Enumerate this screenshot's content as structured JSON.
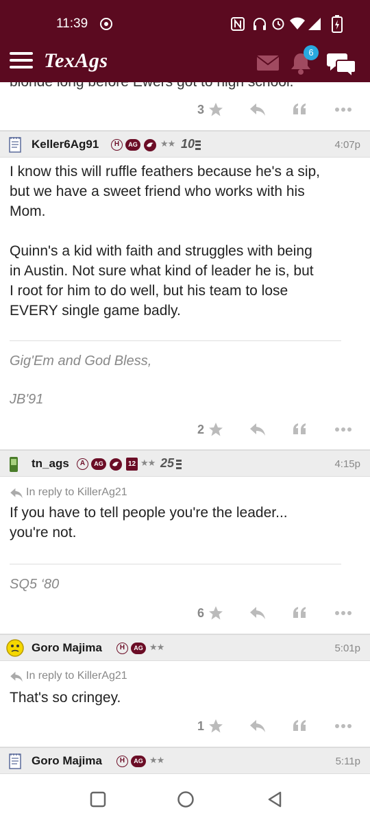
{
  "status_bar": {
    "time": "11:39"
  },
  "app": {
    "logo": "TexAgs",
    "notification_count": "6"
  },
  "prev_post": {
    "cutoff_text": "blonde long before Ewers got to high school.",
    "score": "3"
  },
  "posts": [
    {
      "username": "Keller6Ag91",
      "badge_h": "H",
      "badge_ag": "AG",
      "years": "10",
      "time": "4:07p",
      "reply_to": "",
      "body": [
        "I know this will ruffle feathers because he's a sip,",
        "but we have a sweet friend who works with his",
        "Mom.",
        "",
        "Quinn's a kid with faith and struggles with being",
        "in Austin. Not sure what kind of leader he is, but",
        "I root for him to do well, but his team to lose",
        "EVERY single game badly."
      ],
      "signature": [
        "Gig'Em and God Bless,",
        "JB'91"
      ],
      "score": "2"
    },
    {
      "username": "tn_ags",
      "badge_h": "A",
      "badge_ag": "AG",
      "badge_num": "12",
      "years": "25",
      "time": "4:15p",
      "reply_to": "In reply to KillerAg21",
      "body": [
        "If you have to tell people you're the leader...",
        "you're not."
      ],
      "signature": [
        "SQ5 ‘80"
      ],
      "score": "6"
    },
    {
      "username": "Goro Majima",
      "badge_h": "H",
      "badge_ag": "AG",
      "time": "5:01p",
      "reply_to": "In reply to KillerAg21",
      "body": [
        "That's so cringey."
      ],
      "score": "1"
    },
    {
      "username": "Goro Majima",
      "badge_h": "H",
      "badge_ag": "AG",
      "time": "5:11p"
    }
  ],
  "colors": {
    "maroon": "#5b0a20",
    "badge_blue": "#29a9e0"
  }
}
